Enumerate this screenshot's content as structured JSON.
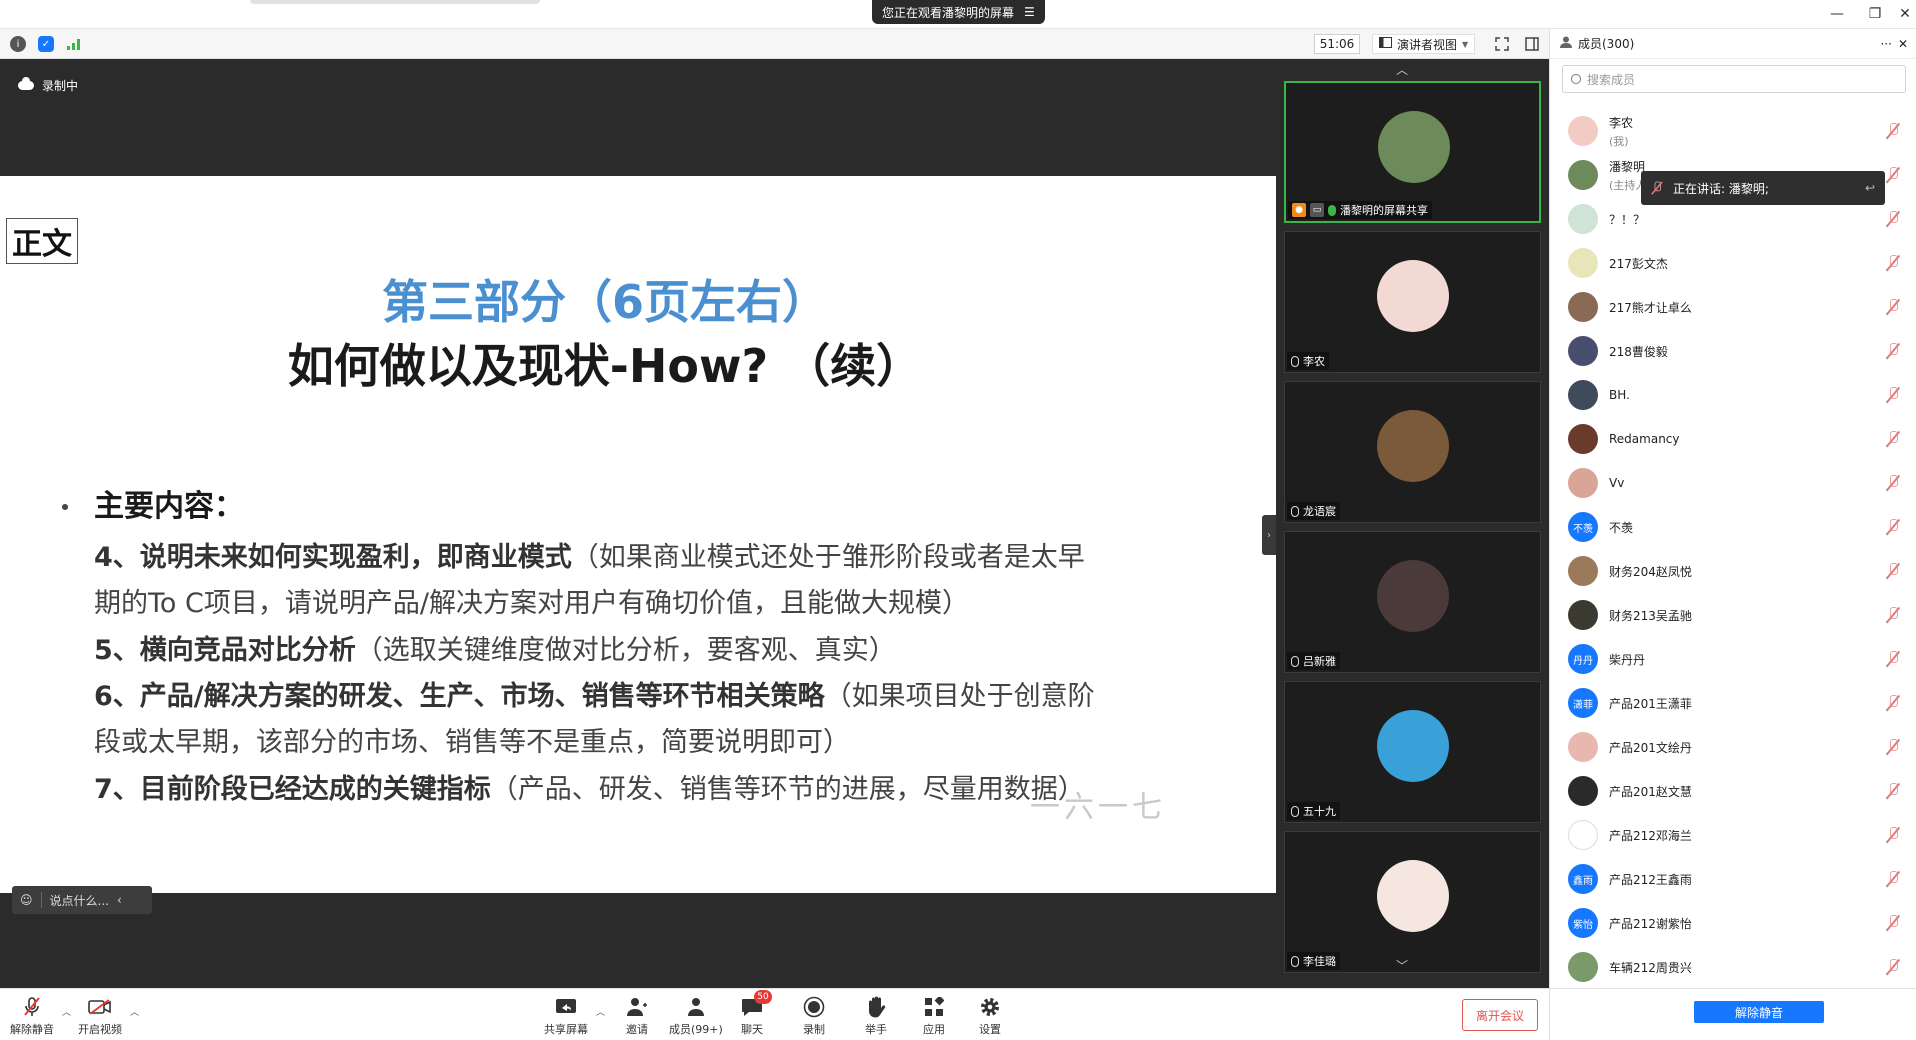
{
  "window": {
    "viewing_banner": "您正在观看潘黎明的屏幕",
    "controls": [
      "—",
      "❐",
      "✕"
    ]
  },
  "toolbar": {
    "timer": "51:06",
    "view_mode": "演讲者视图"
  },
  "stage": {
    "recording_label": "录制中",
    "chat_placeholder": "说点什么...",
    "slide": {
      "tag": "正文",
      "title_line1": "第三部分（6页左右）",
      "title_line2": "如何做以及现状-How? （续）",
      "heading": "主要内容：",
      "items": [
        {
          "bold": "4、说明未来如何实现盈利，即商业模式",
          "normal": "（如果商业模式还处于雏形阶段或者是太早"
        },
        {
          "bold": "",
          "normal": "期的To C项目，请说明产品/解决方案对用户有确切价值，且能做大规模）"
        },
        {
          "bold": "5、横向竞品对比分析",
          "normal": "（选取关键维度做对比分析，要客观、真实）"
        },
        {
          "bold": "6、产品/解决方案的研发、生产、市场、销售等环节相关策略",
          "normal": "（如果项目处于创意阶"
        },
        {
          "bold": "",
          "normal": "段或太早期，该部分的市场、销售等不是重点，简要说明即可）"
        },
        {
          "bold": "7、目前阶段已经达成的关键指标",
          "normal": "（产品、研发、销售等环节的进展，尽量用数据）"
        }
      ],
      "watermark": "一六一七"
    }
  },
  "videos": [
    {
      "name": "潘黎明的屏幕共享",
      "active": true,
      "avatar_color": "#6d8a5a"
    },
    {
      "name": "李农",
      "active": false,
      "avatar_color": "#f3d9d3"
    },
    {
      "name": "龙语宸",
      "active": false,
      "avatar_color": "#7a5a3a"
    },
    {
      "name": "吕新雅",
      "active": false,
      "avatar_color": "#4a3a3a"
    },
    {
      "name": "五十九",
      "active": false,
      "avatar_color": "#3aa0d8"
    },
    {
      "name": "李佳璐",
      "active": false,
      "avatar_color": "#f5e6e0"
    }
  ],
  "participants_panel": {
    "title": "成员(300)",
    "search_placeholder": "搜索成员",
    "speaking_now": "正在讲话: 潘黎明;",
    "unmute_all": "解除静音",
    "members": [
      {
        "name": "李农",
        "sub": "(我)",
        "avatar_text": "",
        "avatar_color": "#f2ccc4"
      },
      {
        "name": "潘黎明",
        "sub": "(主持人)",
        "avatar_text": "",
        "avatar_color": "#6d8a5a"
      },
      {
        "name": "？！？",
        "sub": "",
        "avatar_text": "",
        "avatar_color": "#cfe3d6"
      },
      {
        "name": "217彭文杰",
        "sub": "",
        "avatar_text": "",
        "avatar_color": "#e8e6b8"
      },
      {
        "name": "217熊才让卓么",
        "sub": "",
        "avatar_text": "",
        "avatar_color": "#8a6a55"
      },
      {
        "name": "218曹俊毅",
        "sub": "",
        "avatar_text": "",
        "avatar_color": "#4a4e6e"
      },
      {
        "name": "BH.",
        "sub": "",
        "avatar_text": "",
        "avatar_color": "#3f4a5a"
      },
      {
        "name": "Redamancy",
        "sub": "",
        "avatar_text": "",
        "avatar_color": "#6a3a2a"
      },
      {
        "name": "Vv",
        "sub": "",
        "avatar_text": "",
        "avatar_color": "#d9a596"
      },
      {
        "name": "不羡",
        "sub": "",
        "avatar_text": "不羡",
        "avatar_color": "#1677ff"
      },
      {
        "name": "财务204赵凤悦",
        "sub": "",
        "avatar_text": "",
        "avatar_color": "#9a7a5a"
      },
      {
        "name": "财务213吴孟驰",
        "sub": "",
        "avatar_text": "",
        "avatar_color": "#3a3a30"
      },
      {
        "name": "柴丹丹",
        "sub": "",
        "avatar_text": "丹丹",
        "avatar_color": "#1677ff"
      },
      {
        "name": "产品201王潇菲",
        "sub": "",
        "avatar_text": "潇菲",
        "avatar_color": "#1677ff"
      },
      {
        "name": "产品201文绘丹",
        "sub": "",
        "avatar_text": "",
        "avatar_color": "#e8b8b0"
      },
      {
        "name": "产品201赵文慧",
        "sub": "",
        "avatar_text": "",
        "avatar_color": "#2a2a2a"
      },
      {
        "name": "产品212邓海兰",
        "sub": "",
        "avatar_text": "",
        "avatar_color": "#ffffff"
      },
      {
        "name": "产品212王鑫雨",
        "sub": "",
        "avatar_text": "鑫雨",
        "avatar_color": "#1677ff"
      },
      {
        "name": "产品212谢紫怡",
        "sub": "",
        "avatar_text": "紫怡",
        "avatar_color": "#1677ff"
      },
      {
        "name": "车辆212周贵兴",
        "sub": "",
        "avatar_text": "",
        "avatar_color": "#7a9a6a"
      }
    ]
  },
  "bottom_toolbar": {
    "unmute": "解除静音",
    "start_video": "开启视频",
    "share_screen": "共享屏幕",
    "invite": "邀请",
    "members": "成员(99+)",
    "chat": "聊天",
    "chat_badge": "50",
    "record": "录制",
    "raise_hand": "举手",
    "apps": "应用",
    "settings": "设置",
    "leave": "离开会议"
  }
}
